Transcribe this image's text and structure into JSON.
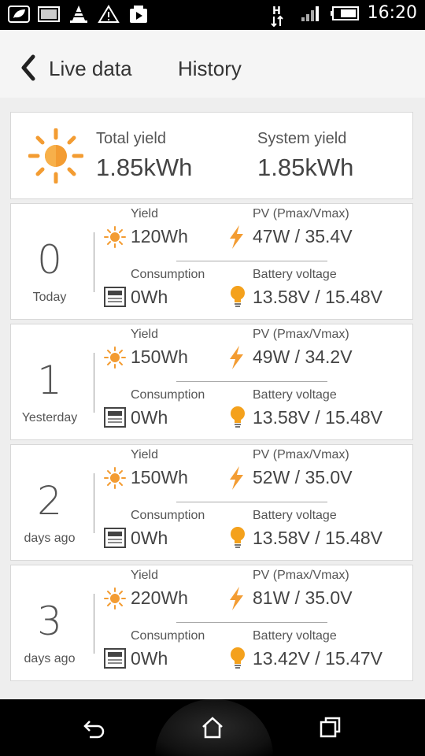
{
  "status_bar": {
    "time": "16:20",
    "left_icons": [
      "leaf-icon",
      "image-icon",
      "vlc-cone-icon",
      "warning-icon",
      "media-share-icon"
    ],
    "right_icons": [
      "h-plus-data-icon",
      "signal-icon",
      "battery-icon"
    ]
  },
  "app_bar": {
    "back_icon": "chevron-left-icon",
    "tab_live": "Live data",
    "tab_history": "History"
  },
  "summary": {
    "total_label": "Total yield",
    "total_value": "1.85kWh",
    "system_label": "System yield",
    "system_value": "1.85kWh"
  },
  "days": [
    {
      "num": "0",
      "label": "Today",
      "yield_label": "Yield",
      "yield_value": "120Wh",
      "pv_label": "PV (Pmax/Vmax)",
      "pv_value": "47W / 35.4V",
      "cons_label": "Consumption",
      "cons_value": "0Wh",
      "batt_label": "Battery voltage",
      "batt_value": "13.58V / 15.48V"
    },
    {
      "num": "1",
      "label": "Yesterday",
      "yield_label": "Yield",
      "yield_value": "150Wh",
      "pv_label": "PV (Pmax/Vmax)",
      "pv_value": "49W / 34.2V",
      "cons_label": "Consumption",
      "cons_value": "0Wh",
      "batt_label": "Battery voltage",
      "batt_value": "13.58V / 15.48V"
    },
    {
      "num": "2",
      "label": "days ago",
      "yield_label": "Yield",
      "yield_value": "150Wh",
      "pv_label": "PV (Pmax/Vmax)",
      "pv_value": "52W / 35.0V",
      "cons_label": "Consumption",
      "cons_value": "0Wh",
      "batt_label": "Battery voltage",
      "batt_value": "13.58V / 15.48V"
    },
    {
      "num": "3",
      "label": "days ago",
      "yield_label": "Yield",
      "yield_value": "220Wh",
      "pv_label": "PV (Pmax/Vmax)",
      "pv_value": "81W / 35.0V",
      "cons_label": "Consumption",
      "cons_value": "0Wh",
      "batt_label": "Battery voltage",
      "batt_value": "13.42V / 15.47V"
    }
  ],
  "nav_bar": {
    "icons": [
      "back-icon",
      "home-icon",
      "recents-icon"
    ]
  },
  "colors": {
    "accent": "#f39c32",
    "bulb": "#f4a11c"
  }
}
